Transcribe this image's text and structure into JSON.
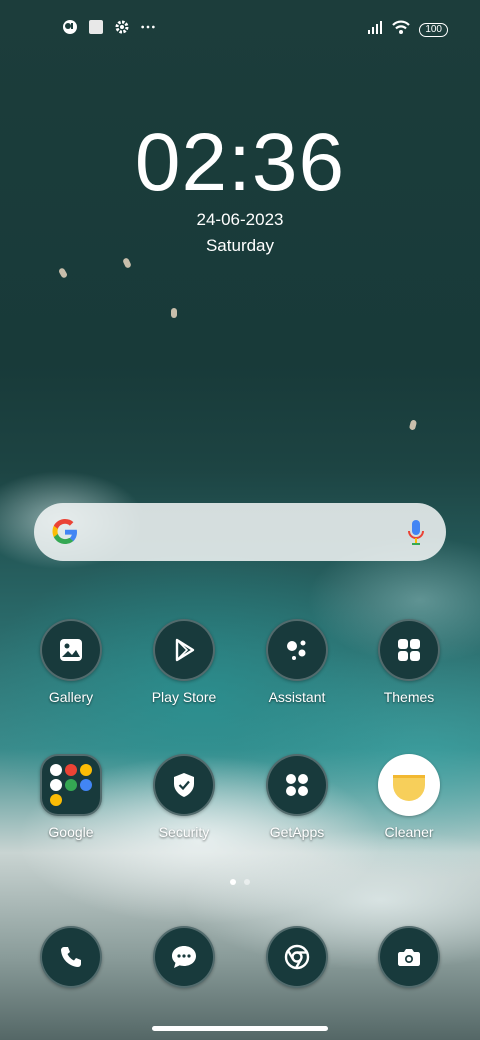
{
  "status_bar": {
    "left_icons": [
      "app-notification-icon",
      "square-notification-icon",
      "settings-icon",
      "more-dots-icon"
    ],
    "battery": "100"
  },
  "lock": {
    "time": "02:36",
    "date": "24-06-2023",
    "day": "Saturday"
  },
  "search": {
    "logo": "google-g-icon",
    "mic": "microphone-icon"
  },
  "apps": [
    {
      "label": "Gallery",
      "icon": "gallery-icon"
    },
    {
      "label": "Play Store",
      "icon": "play-store-icon"
    },
    {
      "label": "Assistant",
      "icon": "assistant-icon"
    },
    {
      "label": "Themes",
      "icon": "themes-icon"
    },
    {
      "label": "Google",
      "icon": "google-folder-icon"
    },
    {
      "label": "Security",
      "icon": "shield-check-icon"
    },
    {
      "label": "GetApps",
      "icon": "getapps-icon"
    },
    {
      "label": "Cleaner",
      "icon": "cleaner-icon"
    }
  ],
  "dock": [
    {
      "name": "phone",
      "icon": "phone-icon"
    },
    {
      "name": "messages",
      "icon": "message-icon"
    },
    {
      "name": "chrome",
      "icon": "chrome-icon"
    },
    {
      "name": "camera",
      "icon": "camera-icon"
    }
  ],
  "page_indicator": {
    "pages": 2,
    "current": 1
  },
  "colors": {
    "icon_bg": "#183a3c",
    "search_bg": "#f5f7f7"
  }
}
